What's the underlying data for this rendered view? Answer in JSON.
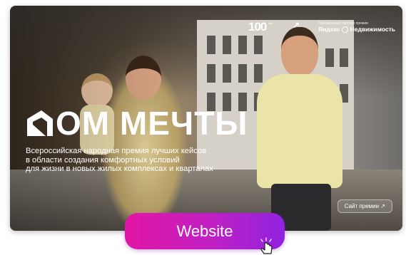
{
  "banner": {
    "brand_mark": "100",
    "brand_mark_sub": "лет",
    "partner_label": "Генеральный партнер премии",
    "partner_name": "Яндекс ◯ Недвижимость",
    "title": "ОМ МЕЧТЫ",
    "subtitle_lines": [
      "Всероссийская народная премия лучших кейсов",
      "в области создания комфортных условий",
      "для жизни в новых жилых комплексах и кварталах"
    ],
    "site_link": "Сайт премии ↗"
  },
  "cta": {
    "label": "Website"
  },
  "colors": {
    "button_gradient_start": "#e316a3",
    "button_gradient_end": "#8f22e1",
    "text": "#ffffff"
  },
  "icons": [
    "house-logo-icon",
    "hand-pointer-icon",
    "arrow-icon"
  ]
}
